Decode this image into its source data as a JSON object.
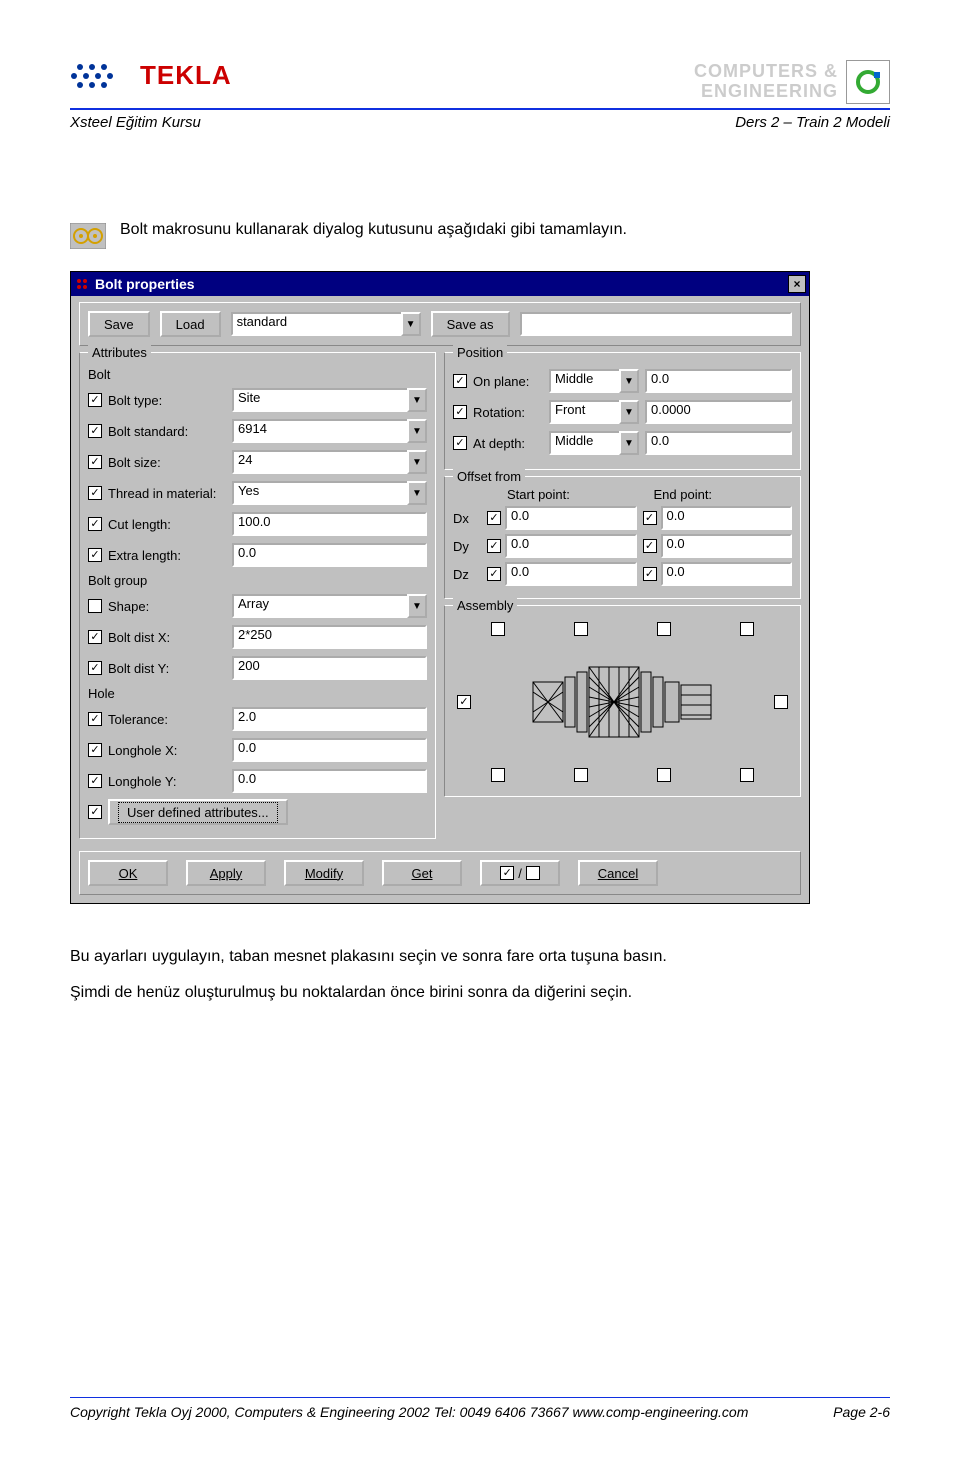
{
  "header": {
    "brand": "TEKLA",
    "ce_line1": "COMPUTERS &",
    "ce_line2": "ENGINEERING",
    "course": "Xsteel Eğitim Kursu",
    "lesson": "Ders 2 – Train 2  Modeli"
  },
  "intro": "Bolt makrosunu kullanarak diyalog kutusunu aşağıdaki gibi tamamlayın.",
  "dialog": {
    "title": "Bolt properties",
    "buttons": {
      "save": "Save",
      "load": "Load",
      "saveas": "Save as",
      "ok": "OK",
      "apply": "Apply",
      "modify": "Modify",
      "get": "Get",
      "cancel": "Cancel"
    },
    "preset": "standard",
    "saveas_name": "",
    "attributes": {
      "legend": "Attributes",
      "bolt_label": "Bolt",
      "bolt_type": {
        "label": "Bolt type:",
        "value": "Site"
      },
      "bolt_standard": {
        "label": "Bolt standard:",
        "value": "6914"
      },
      "bolt_size": {
        "label": "Bolt size:",
        "value": "24"
      },
      "thread": {
        "label": "Thread in material:",
        "value": "Yes"
      },
      "cut_length": {
        "label": "Cut length:",
        "value": "100.0"
      },
      "extra_length": {
        "label": "Extra length:",
        "value": "0.0"
      },
      "group_label": "Bolt group",
      "shape": {
        "label": "Shape:",
        "value": "Array"
      },
      "distx": {
        "label": "Bolt dist X:",
        "value": "2*250"
      },
      "disty": {
        "label": "Bolt dist Y:",
        "value": "200"
      },
      "hole_label": "Hole",
      "tolerance": {
        "label": "Tolerance:",
        "value": "2.0"
      },
      "longx": {
        "label": "Longhole X:",
        "value": "0.0"
      },
      "longy": {
        "label": "Longhole Y:",
        "value": "0.0"
      },
      "uda": "User defined attributes..."
    },
    "position": {
      "legend": "Position",
      "on_plane": {
        "label": "On plane:",
        "sel": "Middle",
        "val": "0.0"
      },
      "rotation": {
        "label": "Rotation:",
        "sel": "Front",
        "val": "0.0000"
      },
      "at_depth": {
        "label": "At depth:",
        "sel": "Middle",
        "val": "0.0"
      }
    },
    "offset": {
      "legend": "Offset from",
      "start": "Start point:",
      "end": "End point:",
      "dx": {
        "label": "Dx",
        "s": "0.0",
        "e": "0.0"
      },
      "dy": {
        "label": "Dy",
        "s": "0.0",
        "e": "0.0"
      },
      "dz": {
        "label": "Dz",
        "s": "0.0",
        "e": "0.0"
      }
    },
    "assembly": {
      "legend": "Assembly"
    }
  },
  "after1": "Bu ayarları uygulayın, taban mesnet plakasını seçin ve sonra fare orta tuşuna basın.",
  "after2": "Şimdi de henüz oluşturulmuş bu noktalardan önce birini sonra da diğerini  seçin.",
  "footer": {
    "copyright": "Copyright Tekla Oyj 2000,  Computers & Engineering 2002  Tel: 0049 6406 73667  www.comp-engineering.com",
    "page": "Page 2-6"
  }
}
